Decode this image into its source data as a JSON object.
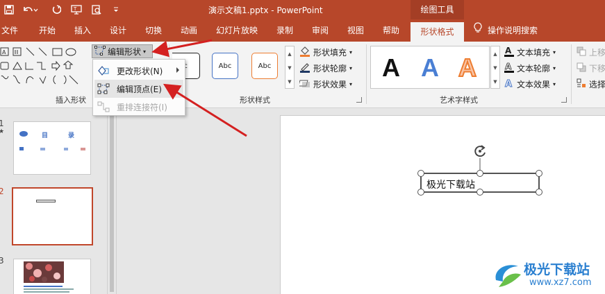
{
  "titlebar": {
    "doc_title": "演示文稿1.pptx  -  PowerPoint",
    "context_tab_group": "绘图工具",
    "accent": "#b7472a",
    "quick_access": [
      "save-icon",
      "undo-icon",
      "redo-icon",
      "slideshow-from-start-icon",
      "print-preview-icon",
      "customize-qat-icon"
    ]
  },
  "tabs": [
    {
      "label": "文件"
    },
    {
      "label": "开始"
    },
    {
      "label": "插入"
    },
    {
      "label": "设计"
    },
    {
      "label": "切换"
    },
    {
      "label": "动画"
    },
    {
      "label": "幻灯片放映"
    },
    {
      "label": "录制"
    },
    {
      "label": "审阅"
    },
    {
      "label": "视图"
    },
    {
      "label": "帮助"
    },
    {
      "label": "形状格式",
      "active": true
    }
  ],
  "tell_me": "操作说明搜索",
  "ribbon": {
    "insert_shapes": {
      "label": "插入形状",
      "edit_shape_button": "编辑形状"
    },
    "shape_styles": {
      "label": "形状样式",
      "samples": [
        "Abc",
        "Abc",
        "Abc"
      ],
      "fill": "形状填充",
      "outline": "形状轮廓",
      "effects": "形状效果"
    },
    "wordart_styles": {
      "label": "艺术字样式",
      "samples": [
        "A",
        "A",
        "A"
      ],
      "text_fill": "文本填充",
      "text_outline": "文本轮廓",
      "text_effects": "文本效果"
    },
    "arrange": {
      "bring_forward": "上移",
      "send_backward": "下移",
      "selection_pane": "选择"
    }
  },
  "edit_shape_menu": {
    "items": [
      {
        "label": "更改形状(N)",
        "has_submenu": true
      },
      {
        "label": "编辑顶点(E)",
        "highlighted": true
      },
      {
        "label": "重排连接符(I)",
        "disabled": true
      }
    ]
  },
  "slides": [
    {
      "number": "1",
      "title_text": "目",
      "title_text2": "录"
    },
    {
      "number": "2",
      "selected": true
    },
    {
      "number": "3"
    }
  ],
  "canvas": {
    "textbox_text": "极光下载站"
  },
  "watermark": {
    "name": "极光下载站",
    "url": "www.xz7.com"
  }
}
